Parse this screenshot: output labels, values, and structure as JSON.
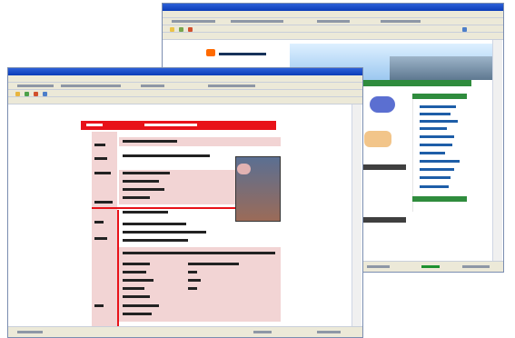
{
  "screens": {
    "back": {
      "has_text": false
    },
    "front": {
      "has_text": false
    }
  },
  "colors": {
    "xp_blue": "#0b3cb8",
    "toolbar": "#ece9d8",
    "green": "#2f8c3d",
    "red": "#e81219",
    "pink": "#f2d4d4"
  }
}
